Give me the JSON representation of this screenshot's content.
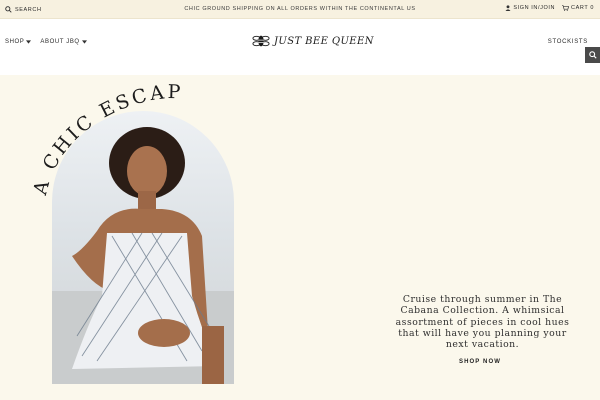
{
  "topbar": {
    "search_label": "SEARCH",
    "promo": "CHIC GROUND SHIPPING ON ALL ORDERS WITHIN THE CONTINENTAL US",
    "sign_in": "SIGN IN/JOIN",
    "cart_label": "CART",
    "cart_count": "0"
  },
  "header": {
    "nav": [
      "SHOP",
      "ABOUT JBQ"
    ],
    "logo_text": "JUST BEE QUEEN",
    "stockists": "STOCKISTS"
  },
  "hero": {
    "arc_title": "A CHIC ESCAPE",
    "copy": "Cruise through summer in The Cabana Collection. A whimsical assortment of pieces in cool hues that will have you planning your next vacation.",
    "cta": "SHOP NOW"
  },
  "icons": {
    "search": "search-icon",
    "user": "user-icon",
    "cart": "cart-icon",
    "chevron": "chevron-down-icon",
    "logo": "bee-logo-icon"
  },
  "colors": {
    "background": "#fbf8ec",
    "topbar": "#f7f1e0",
    "header": "#ffffff",
    "search_button": "#4a4a4a"
  }
}
